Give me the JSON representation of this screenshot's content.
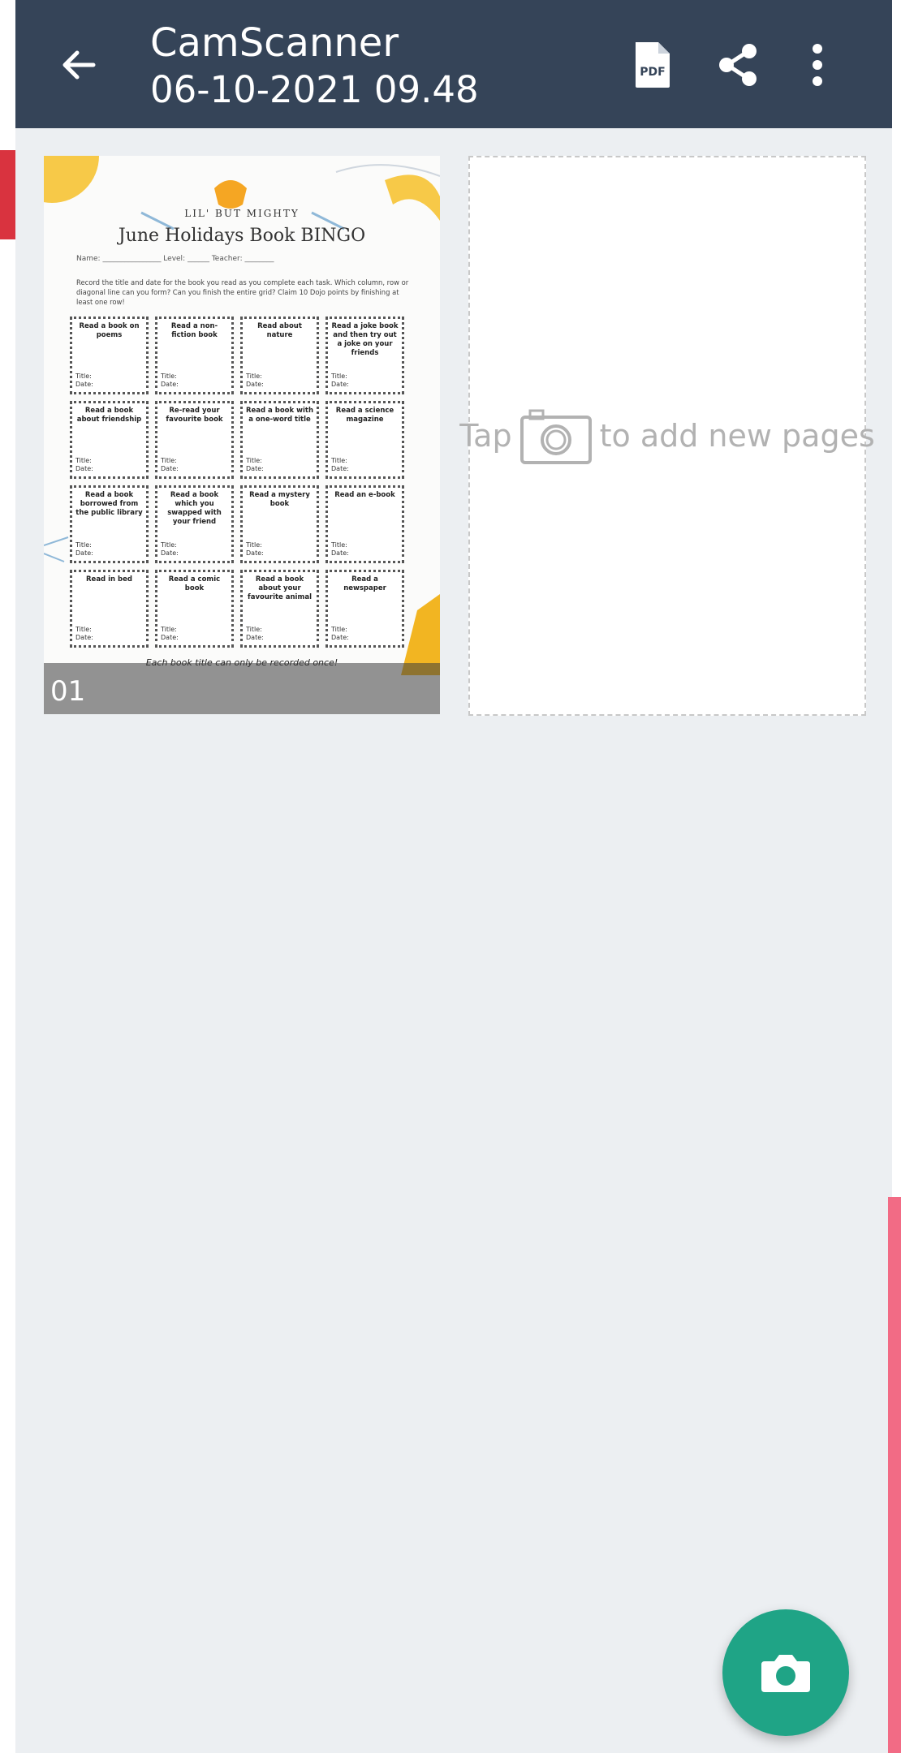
{
  "header": {
    "title": "CamScanner",
    "subtitle": "06-10-2021 09.48",
    "pdf_icon_label": "PDF"
  },
  "pages": [
    {
      "number": "01",
      "document": {
        "brand": "LIL' BUT MIGHTY",
        "title": "June Holidays Book BINGO",
        "fields": "Name: ________________   Level: ______   Teacher: ________",
        "instructions": "Record the title and date for the book you read as you complete each task. Which column, row or diagonal line can you form? Can you finish the entire grid? Claim 10 Dojo points by finishing at least one row!",
        "cells": [
          "Read a book on poems",
          "Read a non-fiction book",
          "Read about nature",
          "Read a joke book and then try out a joke on your friends",
          "Read a book about friendship",
          "Re-read your favourite book",
          "Read a book with a one-word title",
          "Read a science magazine",
          "Read a book borrowed from the public library",
          "Read a book which you swapped with your friend",
          "Read a mystery book",
          "Read an e-book",
          "Read in bed",
          "Read a comic book",
          "Read a book about your favourite animal",
          "Read a newspaper"
        ],
        "cell_fields": "Title:\nDate:",
        "footer": "Each book title can only be recorded once!"
      }
    }
  ],
  "add_page": {
    "prefix": "Tap",
    "suffix": "to add new pages"
  }
}
